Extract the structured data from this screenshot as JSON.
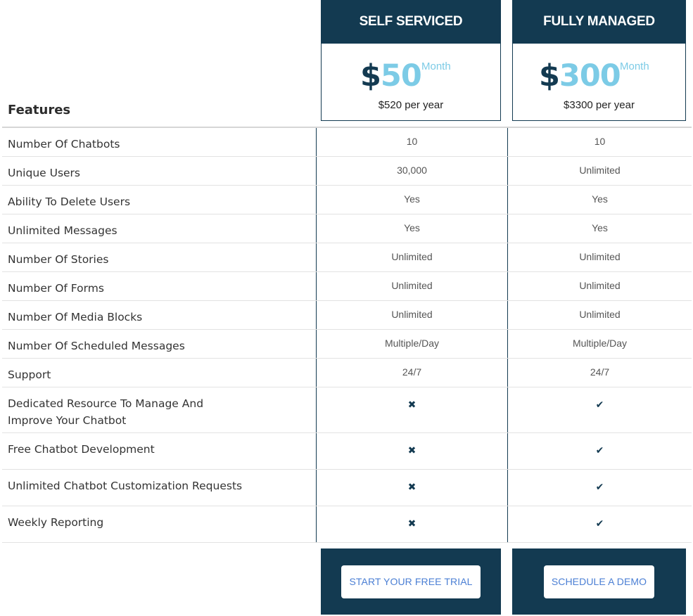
{
  "features_heading": "Features",
  "plans": [
    {
      "title": "SELF SERVICED",
      "currency": "$",
      "amount": "50",
      "period": "Month",
      "yearly": "$520 per year",
      "cta": "START YOUR FREE TRIAL"
    },
    {
      "title": "FULLY MANAGED",
      "currency": "$",
      "amount": "300",
      "period": "Month",
      "yearly": "$3300 per year",
      "cta": "SCHEDULE A DEMO"
    }
  ],
  "rows": [
    {
      "feature": "Number Of Chatbots",
      "self": "10",
      "managed": "10"
    },
    {
      "feature": "Unique Users",
      "self": "30,000",
      "managed": "Unlimited"
    },
    {
      "feature": "Ability To Delete Users",
      "self": "Yes",
      "managed": "Yes"
    },
    {
      "feature": "Unlimited Messages",
      "self": "Yes",
      "managed": "Yes"
    },
    {
      "feature": "Number Of Stories",
      "self": "Unlimited",
      "managed": "Unlimited"
    },
    {
      "feature": "Number Of Forms",
      "self": "Unlimited",
      "managed": "Unlimited"
    },
    {
      "feature": "Number Of Media Blocks",
      "self": "Unlimited",
      "managed": "Unlimited"
    },
    {
      "feature": "Number Of Scheduled Messages",
      "self": "Multiple/Day",
      "managed": "Multiple/Day"
    },
    {
      "feature": "Support",
      "self": "24/7",
      "managed": "24/7"
    },
    {
      "feature": "Dedicated Resource To Manage And Improve Your Chatbot",
      "self_icon": "cross-icon",
      "managed_icon": "check-icon"
    },
    {
      "feature": "Free Chatbot Development",
      "self_icon": "cross-icon",
      "managed_icon": "check-icon"
    },
    {
      "feature": "Unlimited Chatbot Customization Requests",
      "self_icon": "cross-icon",
      "managed_icon": "check-icon"
    },
    {
      "feature": "Weekly Reporting",
      "self_icon": "cross-icon",
      "managed_icon": "check-icon"
    }
  ],
  "colors": {
    "navy": "#133a51",
    "light_blue": "#7ccbe6",
    "link_blue": "#4b7fd4"
  }
}
